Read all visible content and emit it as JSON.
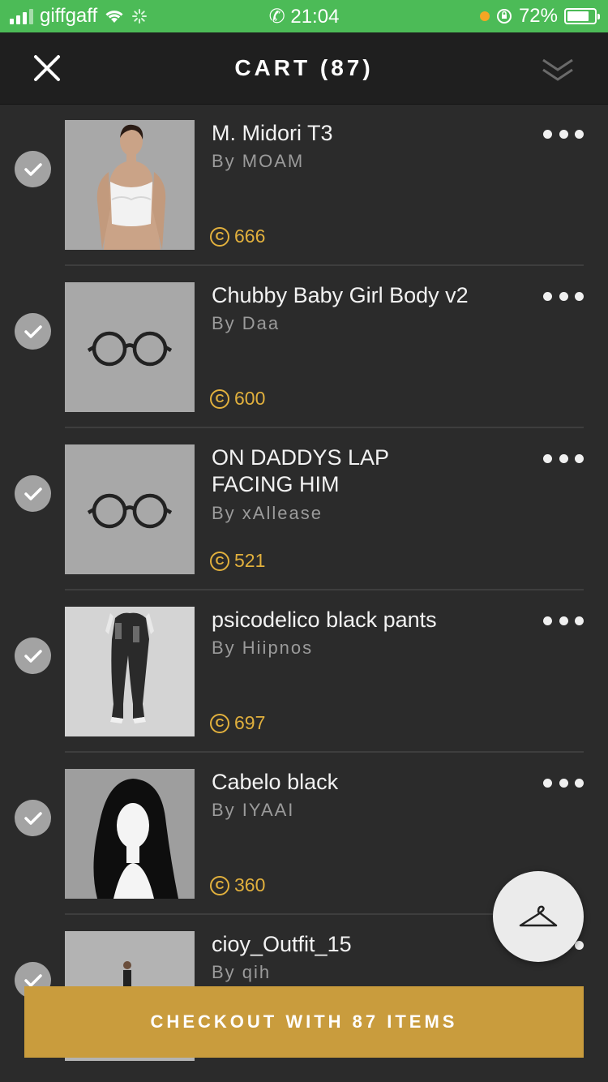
{
  "status": {
    "carrier": "giffgaff",
    "time": "21:04",
    "battery": "72%"
  },
  "header": {
    "title": "CART (87)"
  },
  "items": [
    {
      "name": "M. Midori T3",
      "by": "By MOAM",
      "price": "666"
    },
    {
      "name": "Chubby Baby Girl Body v2",
      "by": "By Daa",
      "price": "600"
    },
    {
      "name": "ON DADDYS LAP FACING HIM",
      "by": "By xAllease",
      "price": "521"
    },
    {
      "name": "psicodelico black pants",
      "by": "By Hiipnos",
      "price": "697"
    },
    {
      "name": "Cabelo black",
      "by": "By IYAAI",
      "price": "360"
    },
    {
      "name": "cioy_Outfit_15",
      "by": "By qih",
      "price": ""
    }
  ],
  "coin_symbol": "C",
  "checkout": {
    "label": "CHECKOUT WITH 87 ITEMS"
  },
  "colors": {
    "status_bar": "#4cbb57",
    "accent_gold": "#c99c3d",
    "price_gold": "#e1b03d",
    "background": "#2b2b2b"
  },
  "icons": [
    "close-icon",
    "collapse-icon",
    "check-icon",
    "more-icon",
    "glasses-icon",
    "hanger-icon",
    "coin-icon"
  ]
}
